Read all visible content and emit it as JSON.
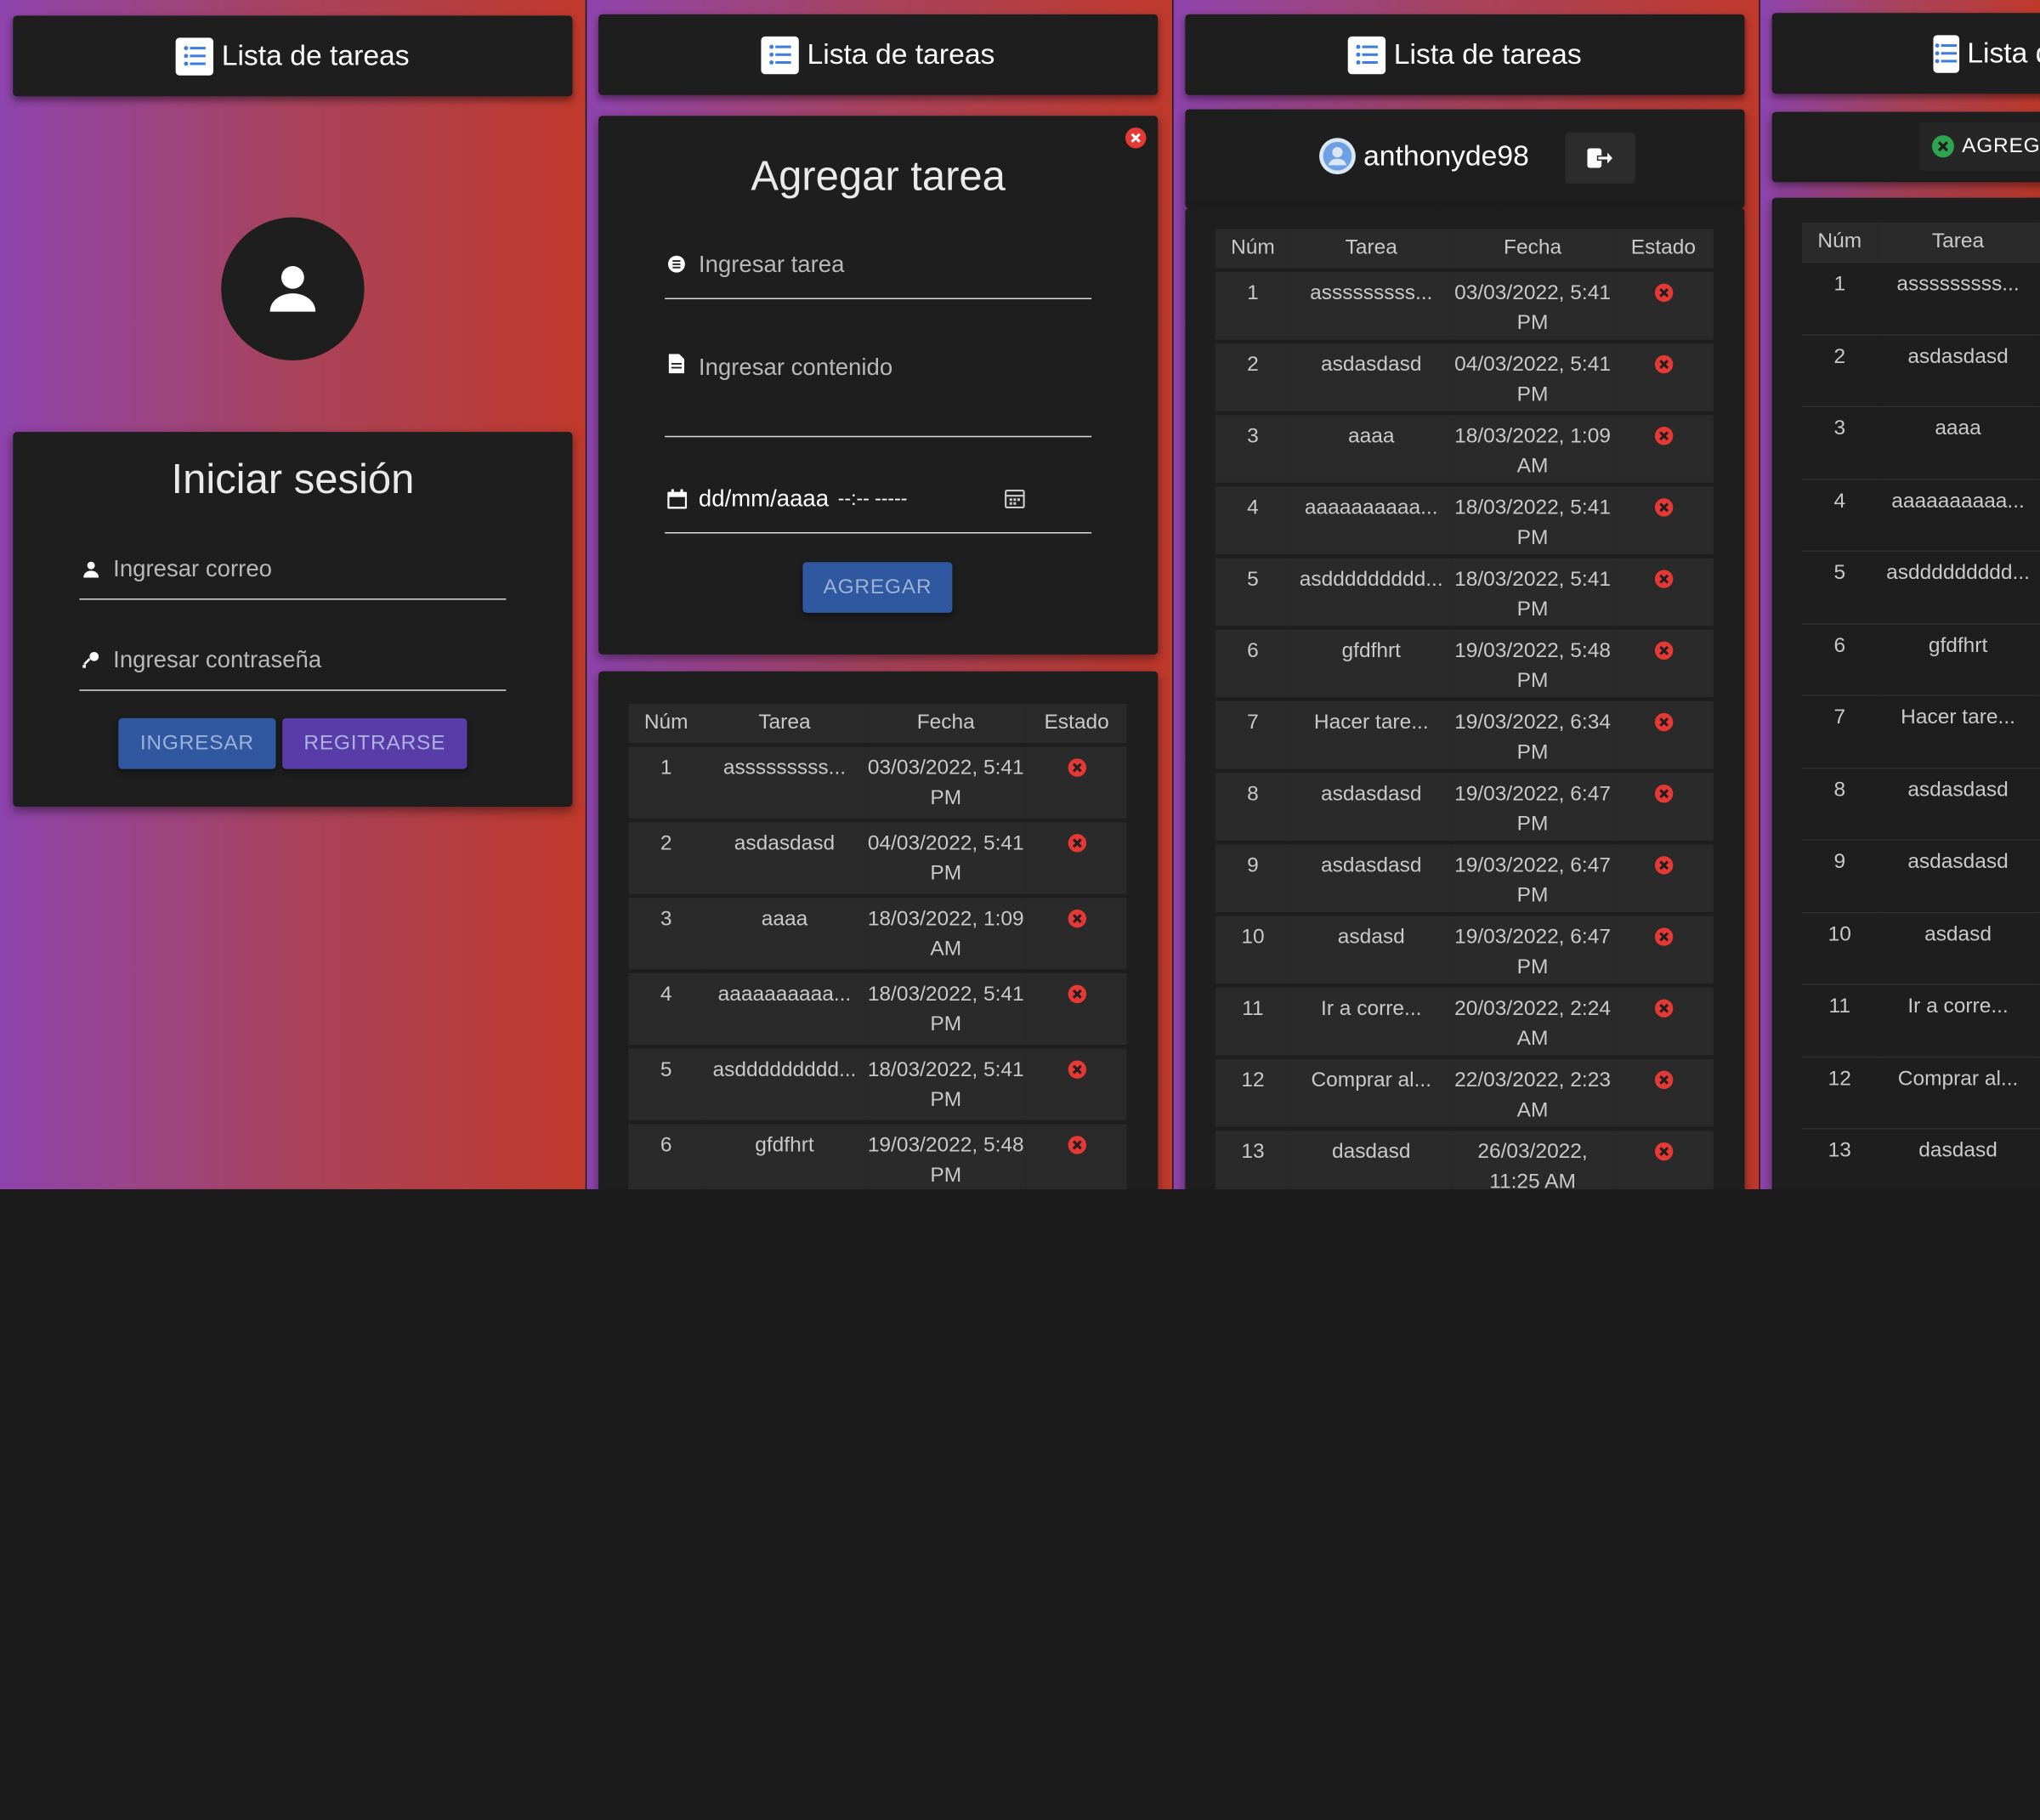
{
  "app": {
    "title": "Lista de tareas"
  },
  "login": {
    "heading": "Iniciar sesión",
    "email_placeholder": "Ingresar correo",
    "password_placeholder": "Ingresar contraseña",
    "login_button": "INGRESAR",
    "register_button": "REGITRARSE"
  },
  "add_task": {
    "heading": "Agregar tarea",
    "task_placeholder": "Ingresar tarea",
    "content_placeholder": "Ingresar contenido",
    "date_placeholder": "dd/mm/aaaa",
    "time_placeholder": "--:-- -----",
    "add_button": "AGREGAR"
  },
  "user": {
    "username": "anthonyde98"
  },
  "panel4": {
    "button_partial": "AGREG"
  },
  "table": {
    "headers": [
      "Núm",
      "Tarea",
      "Fecha",
      "Estado"
    ],
    "rows": [
      {
        "num": "1",
        "task": "asssssssss...",
        "date1": "03/03/2022, 5:41",
        "date2": "PM"
      },
      {
        "num": "2",
        "task": "asdasdasd",
        "date1": "04/03/2022, 5:41",
        "date2": "PM"
      },
      {
        "num": "3",
        "task": "aaaa",
        "date1": "18/03/2022, 1:09",
        "date2": "AM"
      },
      {
        "num": "4",
        "task": "aaaaaaaaaa...",
        "date1": "18/03/2022, 5:41",
        "date2": "PM"
      },
      {
        "num": "5",
        "task": "asddddddddd...",
        "date1": "18/03/2022, 5:41",
        "date2": "PM"
      },
      {
        "num": "6",
        "task": "gfdfhrt",
        "date1": "19/03/2022, 5:48",
        "date2": "PM"
      },
      {
        "num": "7",
        "task": "Hacer tare...",
        "date1": "19/03/2022, 6:34",
        "date2": "PM"
      },
      {
        "num": "8",
        "task": "asdasdasd",
        "date1": "19/03/2022, 6:47",
        "date2": "PM"
      },
      {
        "num": "9",
        "task": "asdasdasd",
        "date1": "19/03/2022, 6:47",
        "date2": "PM"
      },
      {
        "num": "10",
        "task": "asdasd",
        "date1": "19/03/2022, 6:47",
        "date2": "PM"
      },
      {
        "num": "11",
        "task": "Ir a corre...",
        "date1": "20/03/2022, 2:24",
        "date2": "AM"
      },
      {
        "num": "12",
        "task": "Comprar al...",
        "date1": "22/03/2022, 2:23",
        "date2": "AM"
      },
      {
        "num": "13",
        "task": "dasdasd",
        "date1": "26/03/2022,",
        "date2": "11:25 AM"
      }
    ]
  },
  "colors": {
    "card": "#1e1e1e",
    "row": "#2a2a2a",
    "status_x": "#e53935",
    "accent_blue": "#2f58a0",
    "accent_purple": "#5a3ca8"
  }
}
